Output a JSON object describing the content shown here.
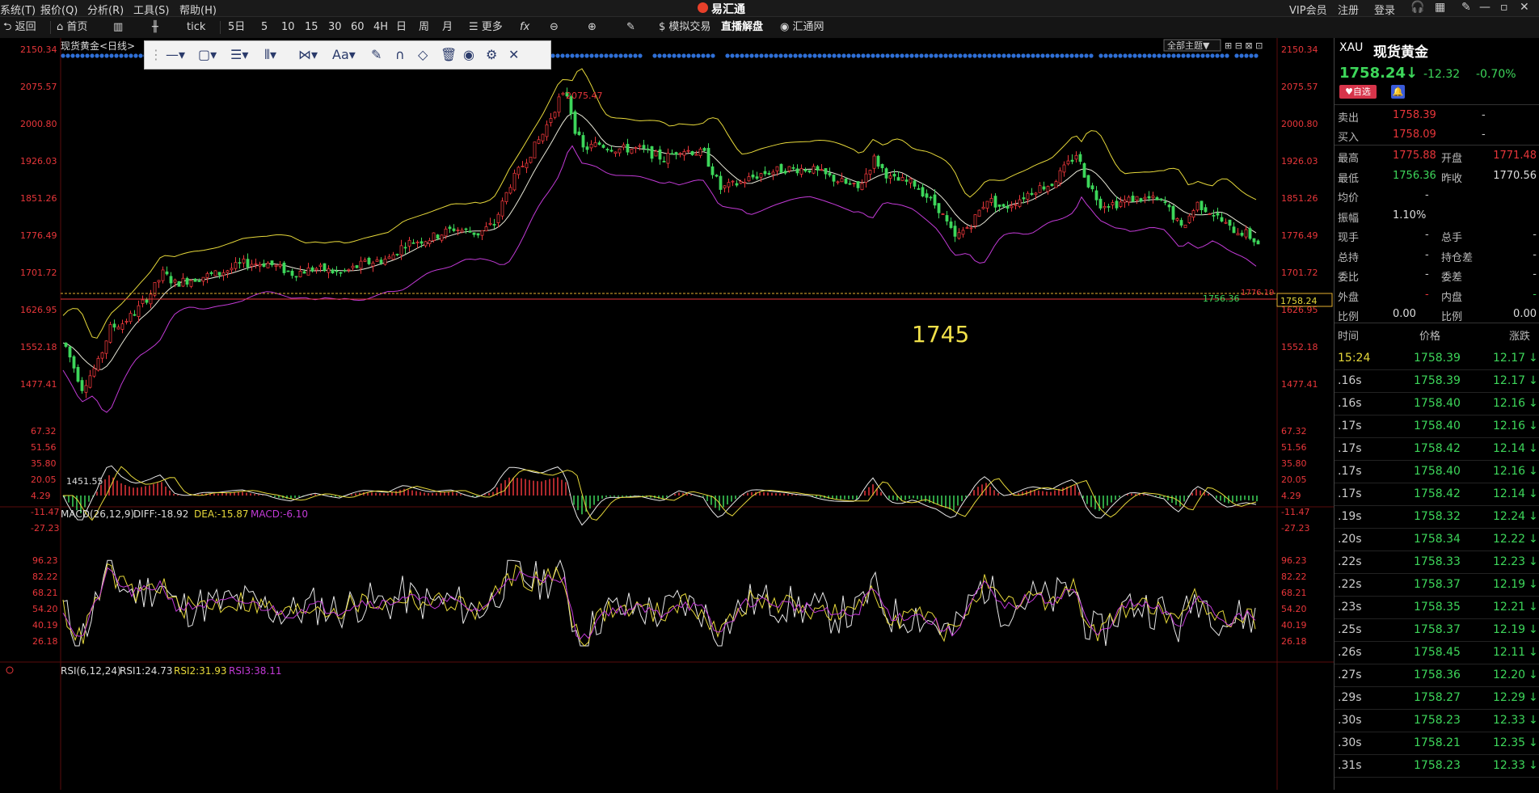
{
  "menubar": {
    "items": [
      "系统(T)",
      "报价(Q)",
      "分析(R)",
      "工具(S)",
      "帮助(H)"
    ],
    "app_title": "易汇通",
    "right_links": [
      "VIP会员",
      "注册",
      "登录"
    ]
  },
  "toolbar": {
    "back": "返回",
    "home": "首页",
    "tick": "tick",
    "periods": [
      "5日",
      "5",
      "10",
      "15",
      "30",
      "60",
      "4H",
      "日",
      "周",
      "月"
    ],
    "more": "更多",
    "fx": "fx",
    "sim_trade": "模拟交易",
    "live": "直播解盘",
    "hui_tong": "汇通网"
  },
  "chart": {
    "symbol_label": "现货黄金<日线>",
    "theme_button": "全部主题▼",
    "price_ticks": [
      "2150.34",
      "2075.57",
      "2000.80",
      "1926.03",
      "1851.26",
      "1776.49",
      "1701.72",
      "1626.95",
      "1552.18",
      "1477.41"
    ],
    "high_label": "2075.47",
    "low_label": "1451.55",
    "last_low_label": "1756.36",
    "current_price_tag": "1758.24",
    "yellow_line_tag": "1776.19",
    "annotation": "1745",
    "macd_title": "MACD(26,12,9)",
    "macd_diff": "DIFF:-18.92",
    "macd_dea": "DEA:-15.87",
    "macd_macd": "MACD:-6.10",
    "macd_ticks": [
      "67.32",
      "51.56",
      "35.80",
      "20.05",
      "4.29",
      "-11.47",
      "-27.23"
    ],
    "rsi_title": "RSI(6,12,24)",
    "rsi1": "RSI1:24.73",
    "rsi2": "RSI2:31.93",
    "rsi3": "RSI3:38.11",
    "rsi_ticks": [
      "96.23",
      "82.22",
      "68.21",
      "54.20",
      "40.19",
      "26.18"
    ],
    "colors": {
      "up": "#e8363a",
      "down": "#3dd65a",
      "boll_mid": "#e8e8d8",
      "boll_up": "#e6d83a",
      "boll_dn": "#c23ad6"
    }
  },
  "panel": {
    "code": "XAU",
    "name": "现货黄金",
    "price": "1758.24",
    "arrow": "↓",
    "change": "-12.32",
    "pct": "-0.70%",
    "fav": "♥自选",
    "sell_label": "卖出",
    "sell": "1758.39",
    "sell_r": "-",
    "buy_label": "买入",
    "buy": "1758.09",
    "buy_r": "-",
    "stats": [
      {
        "l1": "最高",
        "v1": "1775.88",
        "l2": "开盘",
        "v2": "1771.48",
        "c1": "#e8363a",
        "c2": "#e8363a"
      },
      {
        "l1": "最低",
        "v1": "1756.36",
        "l2": "昨收",
        "v2": "1770.56",
        "c1": "#3dd65a",
        "c2": "#dddddd"
      },
      {
        "l1": "均价",
        "v1": "-",
        "l2": "",
        "v2": "",
        "c1": "#ccc",
        "c2": "#ccc"
      },
      {
        "l1": "振幅",
        "v1": "1.10%",
        "l2": "",
        "v2": "",
        "c1": "#dddddd",
        "c2": "#ccc"
      },
      {
        "l1": "现手",
        "v1": "-",
        "l2": "总手",
        "v2": "-",
        "c1": "#ccc",
        "c2": "#ccc"
      },
      {
        "l1": "总持",
        "v1": "-",
        "l2": "持仓差",
        "v2": "-",
        "c1": "#ccc",
        "c2": "#ccc"
      },
      {
        "l1": "委比",
        "v1": "-",
        "l2": "委差",
        "v2": "-",
        "c1": "#ccc",
        "c2": "#ccc"
      },
      {
        "l1": "外盘",
        "v1": "-",
        "l2": "内盘",
        "v2": "-",
        "c1": "#e8363a",
        "c2": "#3dd65a"
      },
      {
        "l1": "比例",
        "v1": "0.00",
        "l2": "比例",
        "v2": "0.00",
        "c1": "#dddddd",
        "c2": "#dddddd"
      }
    ],
    "tick_headers": [
      "时间",
      "价格",
      "涨跌"
    ],
    "ticks": [
      {
        "t": "15:24",
        "p": "1758.39",
        "c": "12.17"
      },
      {
        "t": ".16s",
        "p": "1758.39",
        "c": "12.17"
      },
      {
        "t": ".16s",
        "p": "1758.40",
        "c": "12.16"
      },
      {
        "t": ".17s",
        "p": "1758.40",
        "c": "12.16"
      },
      {
        "t": ".17s",
        "p": "1758.42",
        "c": "12.14"
      },
      {
        "t": ".17s",
        "p": "1758.40",
        "c": "12.16"
      },
      {
        "t": ".17s",
        "p": "1758.42",
        "c": "12.14"
      },
      {
        "t": ".19s",
        "p": "1758.32",
        "c": "12.24"
      },
      {
        "t": ".20s",
        "p": "1758.34",
        "c": "12.22"
      },
      {
        "t": ".22s",
        "p": "1758.33",
        "c": "12.23"
      },
      {
        "t": ".22s",
        "p": "1758.37",
        "c": "12.19"
      },
      {
        "t": ".23s",
        "p": "1758.35",
        "c": "12.21"
      },
      {
        "t": ".25s",
        "p": "1758.37",
        "c": "12.19"
      },
      {
        "t": ".26s",
        "p": "1758.45",
        "c": "12.11"
      },
      {
        "t": ".27s",
        "p": "1758.36",
        "c": "12.20"
      },
      {
        "t": ".29s",
        "p": "1758.27",
        "c": "12.29"
      },
      {
        "t": ".30s",
        "p": "1758.23",
        "c": "12.33"
      },
      {
        "t": ".30s",
        "p": "1758.21",
        "c": "12.35"
      },
      {
        "t": ".31s",
        "p": "1758.23",
        "c": "12.33"
      }
    ]
  }
}
